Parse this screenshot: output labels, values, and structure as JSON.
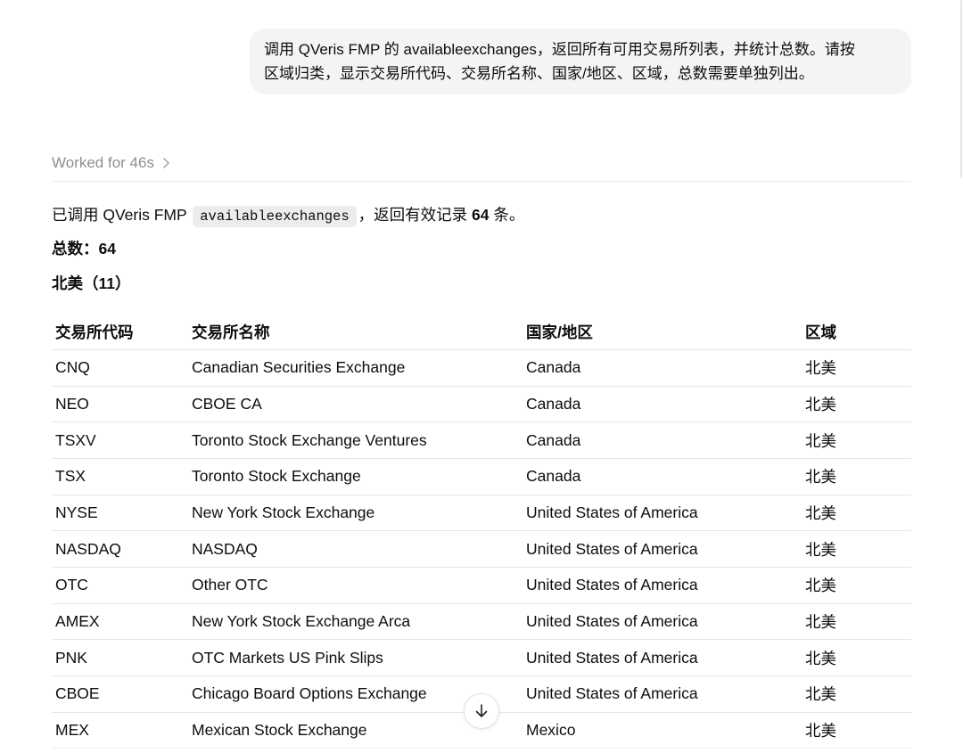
{
  "user_message": {
    "lines": [
      "调用 QVeris FMP 的 availableexchanges，返回所有可用交易所列表，并统计总数。请按",
      "区域归类，显示交易所代码、交易所名称、国家/地区、区域，总数需要单独列出。"
    ]
  },
  "assistant": {
    "worked": {
      "label": "Worked for 46s",
      "icon": "chevron-right-icon"
    },
    "intro": {
      "prefix": "已调用 QVeris FMP ",
      "code": "availableexchanges",
      "middle": "，返回有效记录 ",
      "count": "64",
      "suffix": " 条。"
    },
    "total_line": "总数：64",
    "section_heading": "北美（11）",
    "table": {
      "headers": [
        "交易所代码",
        "交易所名称",
        "国家/地区",
        "区域"
      ],
      "rows": [
        {
          "code": "CNQ",
          "name": "Canadian Securities Exchange",
          "country": "Canada",
          "region": "北美"
        },
        {
          "code": "NEO",
          "name": "CBOE CA",
          "country": "Canada",
          "region": "北美"
        },
        {
          "code": "TSXV",
          "name": "Toronto Stock Exchange Ventures",
          "country": "Canada",
          "region": "北美"
        },
        {
          "code": "TSX",
          "name": "Toronto Stock Exchange",
          "country": "Canada",
          "region": "北美"
        },
        {
          "code": "NYSE",
          "name": "New York Stock Exchange",
          "country": "United States of America",
          "region": "北美"
        },
        {
          "code": "NASDAQ",
          "name": "NASDAQ",
          "country": "United States of America",
          "region": "北美"
        },
        {
          "code": "OTC",
          "name": "Other OTC",
          "country": "United States of America",
          "region": "北美"
        },
        {
          "code": "AMEX",
          "name": "New York Stock Exchange Arca",
          "country": "United States of America",
          "region": "北美"
        },
        {
          "code": "PNK",
          "name": "OTC Markets US Pink Slips",
          "country": "United States of America",
          "region": "北美"
        },
        {
          "code": "CBOE",
          "name": "Chicago Board Options Exchange",
          "country": "United States of America",
          "region": "北美"
        },
        {
          "code": "MEX",
          "name": "Mexican Stock Exchange",
          "country": "Mexico",
          "region": "北美"
        }
      ]
    }
  },
  "scroll_button": {
    "icon": "arrow-down-icon"
  },
  "colors": {
    "text": "#0d0d0d",
    "muted": "#8f8f8f",
    "bubble_bg": "#f4f4f4",
    "code_bg": "#ececec",
    "border": "#e5e5e5"
  }
}
